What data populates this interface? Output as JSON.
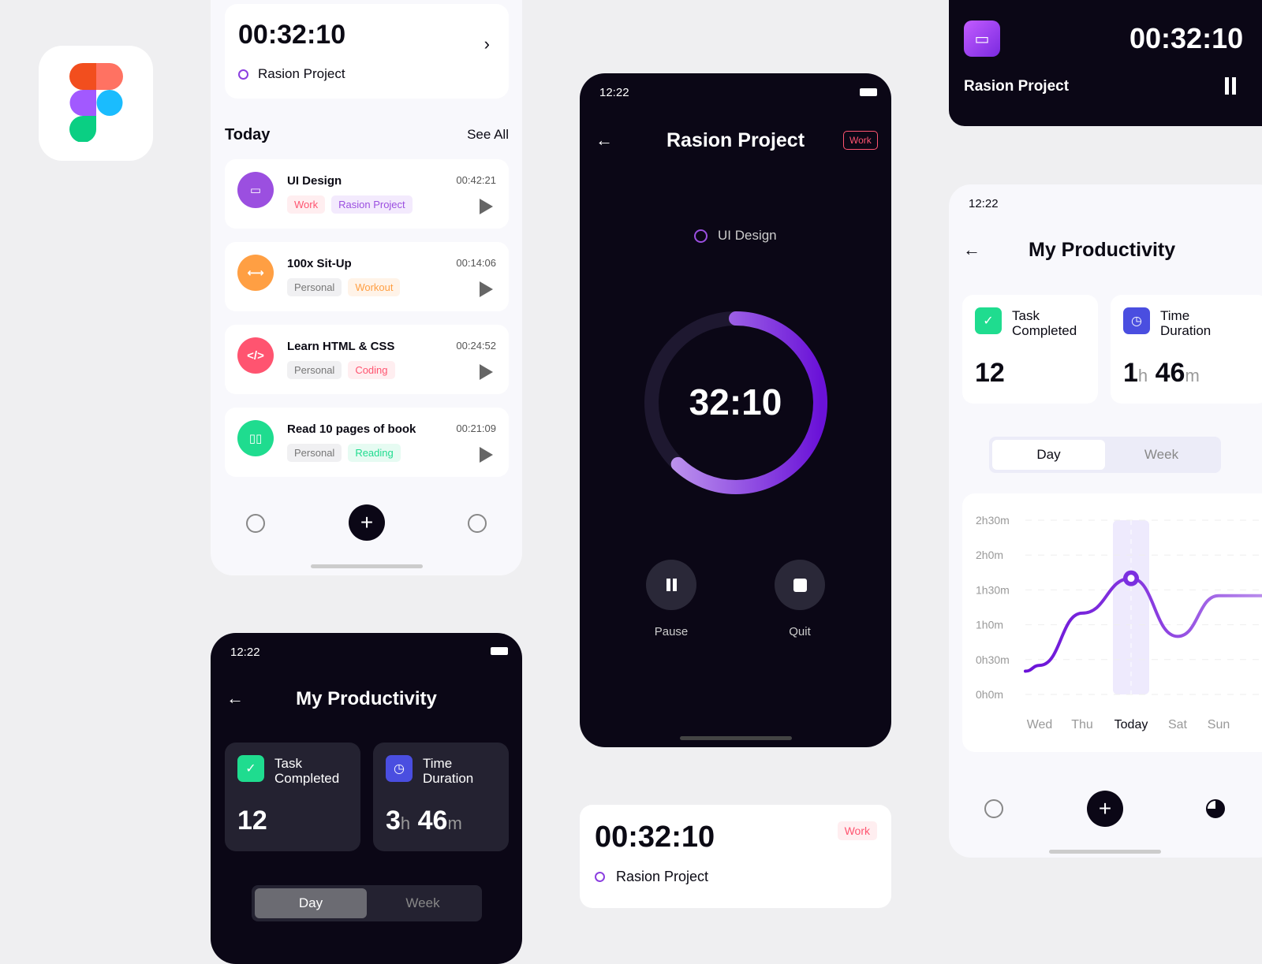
{
  "logo": {
    "name": "figma-logo"
  },
  "top_timer": {
    "time": "00:32:10",
    "project": "Rasion Project"
  },
  "today": {
    "title": "Today",
    "see_all": "See All",
    "tasks": [
      {
        "title": "UI Design",
        "time": "00:42:21",
        "tags": [
          "Work",
          "Rasion Project"
        ],
        "icon": "monitor-icon",
        "color": "#9b4fe0"
      },
      {
        "title": "100x Sit-Up",
        "time": "00:14:06",
        "tags": [
          "Personal",
          "Workout"
        ],
        "icon": "dumbbell-icon",
        "color": "#ff9f43"
      },
      {
        "title": "Learn HTML & CSS",
        "time": "00:24:52",
        "tags": [
          "Personal",
          "Coding"
        ],
        "icon": "code-icon",
        "color": "#ff5470"
      },
      {
        "title": "Read 10 pages of book",
        "time": "00:21:09",
        "tags": [
          "Personal",
          "Reading"
        ],
        "icon": "book-icon",
        "color": "#1fdc8f"
      }
    ]
  },
  "status": {
    "time": "12:22"
  },
  "timer_screen": {
    "title": "Rasion Project",
    "badge": "Work",
    "task": "UI Design",
    "time": "32:10",
    "progress": 0.62,
    "pause": "Pause",
    "quit": "Quit"
  },
  "bottom_card": {
    "time": "00:32:10",
    "project": "Rasion Project",
    "badge": "Work"
  },
  "widget": {
    "time": "00:32:10",
    "project": "Rasion Project"
  },
  "productivity_dark": {
    "title": "My Productivity",
    "task_label": "Task Completed",
    "task_value": "12",
    "time_label": "Time Duration",
    "hours": "3",
    "minutes": "46",
    "h": "h",
    "m": "m",
    "day": "Day",
    "week": "Week"
  },
  "productivity_light": {
    "title": "My Productivity",
    "task_label": "Task Completed",
    "task_value": "12",
    "time_label": "Time Duration",
    "hours": "1",
    "minutes": "46",
    "h": "h",
    "m": "m",
    "day": "Day",
    "week": "Week"
  },
  "chart_data": {
    "type": "line",
    "categories": [
      "Wed",
      "Thu",
      "Today",
      "Sat",
      "Sun"
    ],
    "values_minutes": [
      25,
      70,
      100,
      50,
      85
    ],
    "y_ticks": [
      "0h0m",
      "0h30m",
      "1h0m",
      "1h30m",
      "2h0m",
      "2h30m"
    ],
    "ylim": [
      0,
      150
    ],
    "highlight": "Today",
    "grid": true,
    "color": "#7b2fe0"
  }
}
